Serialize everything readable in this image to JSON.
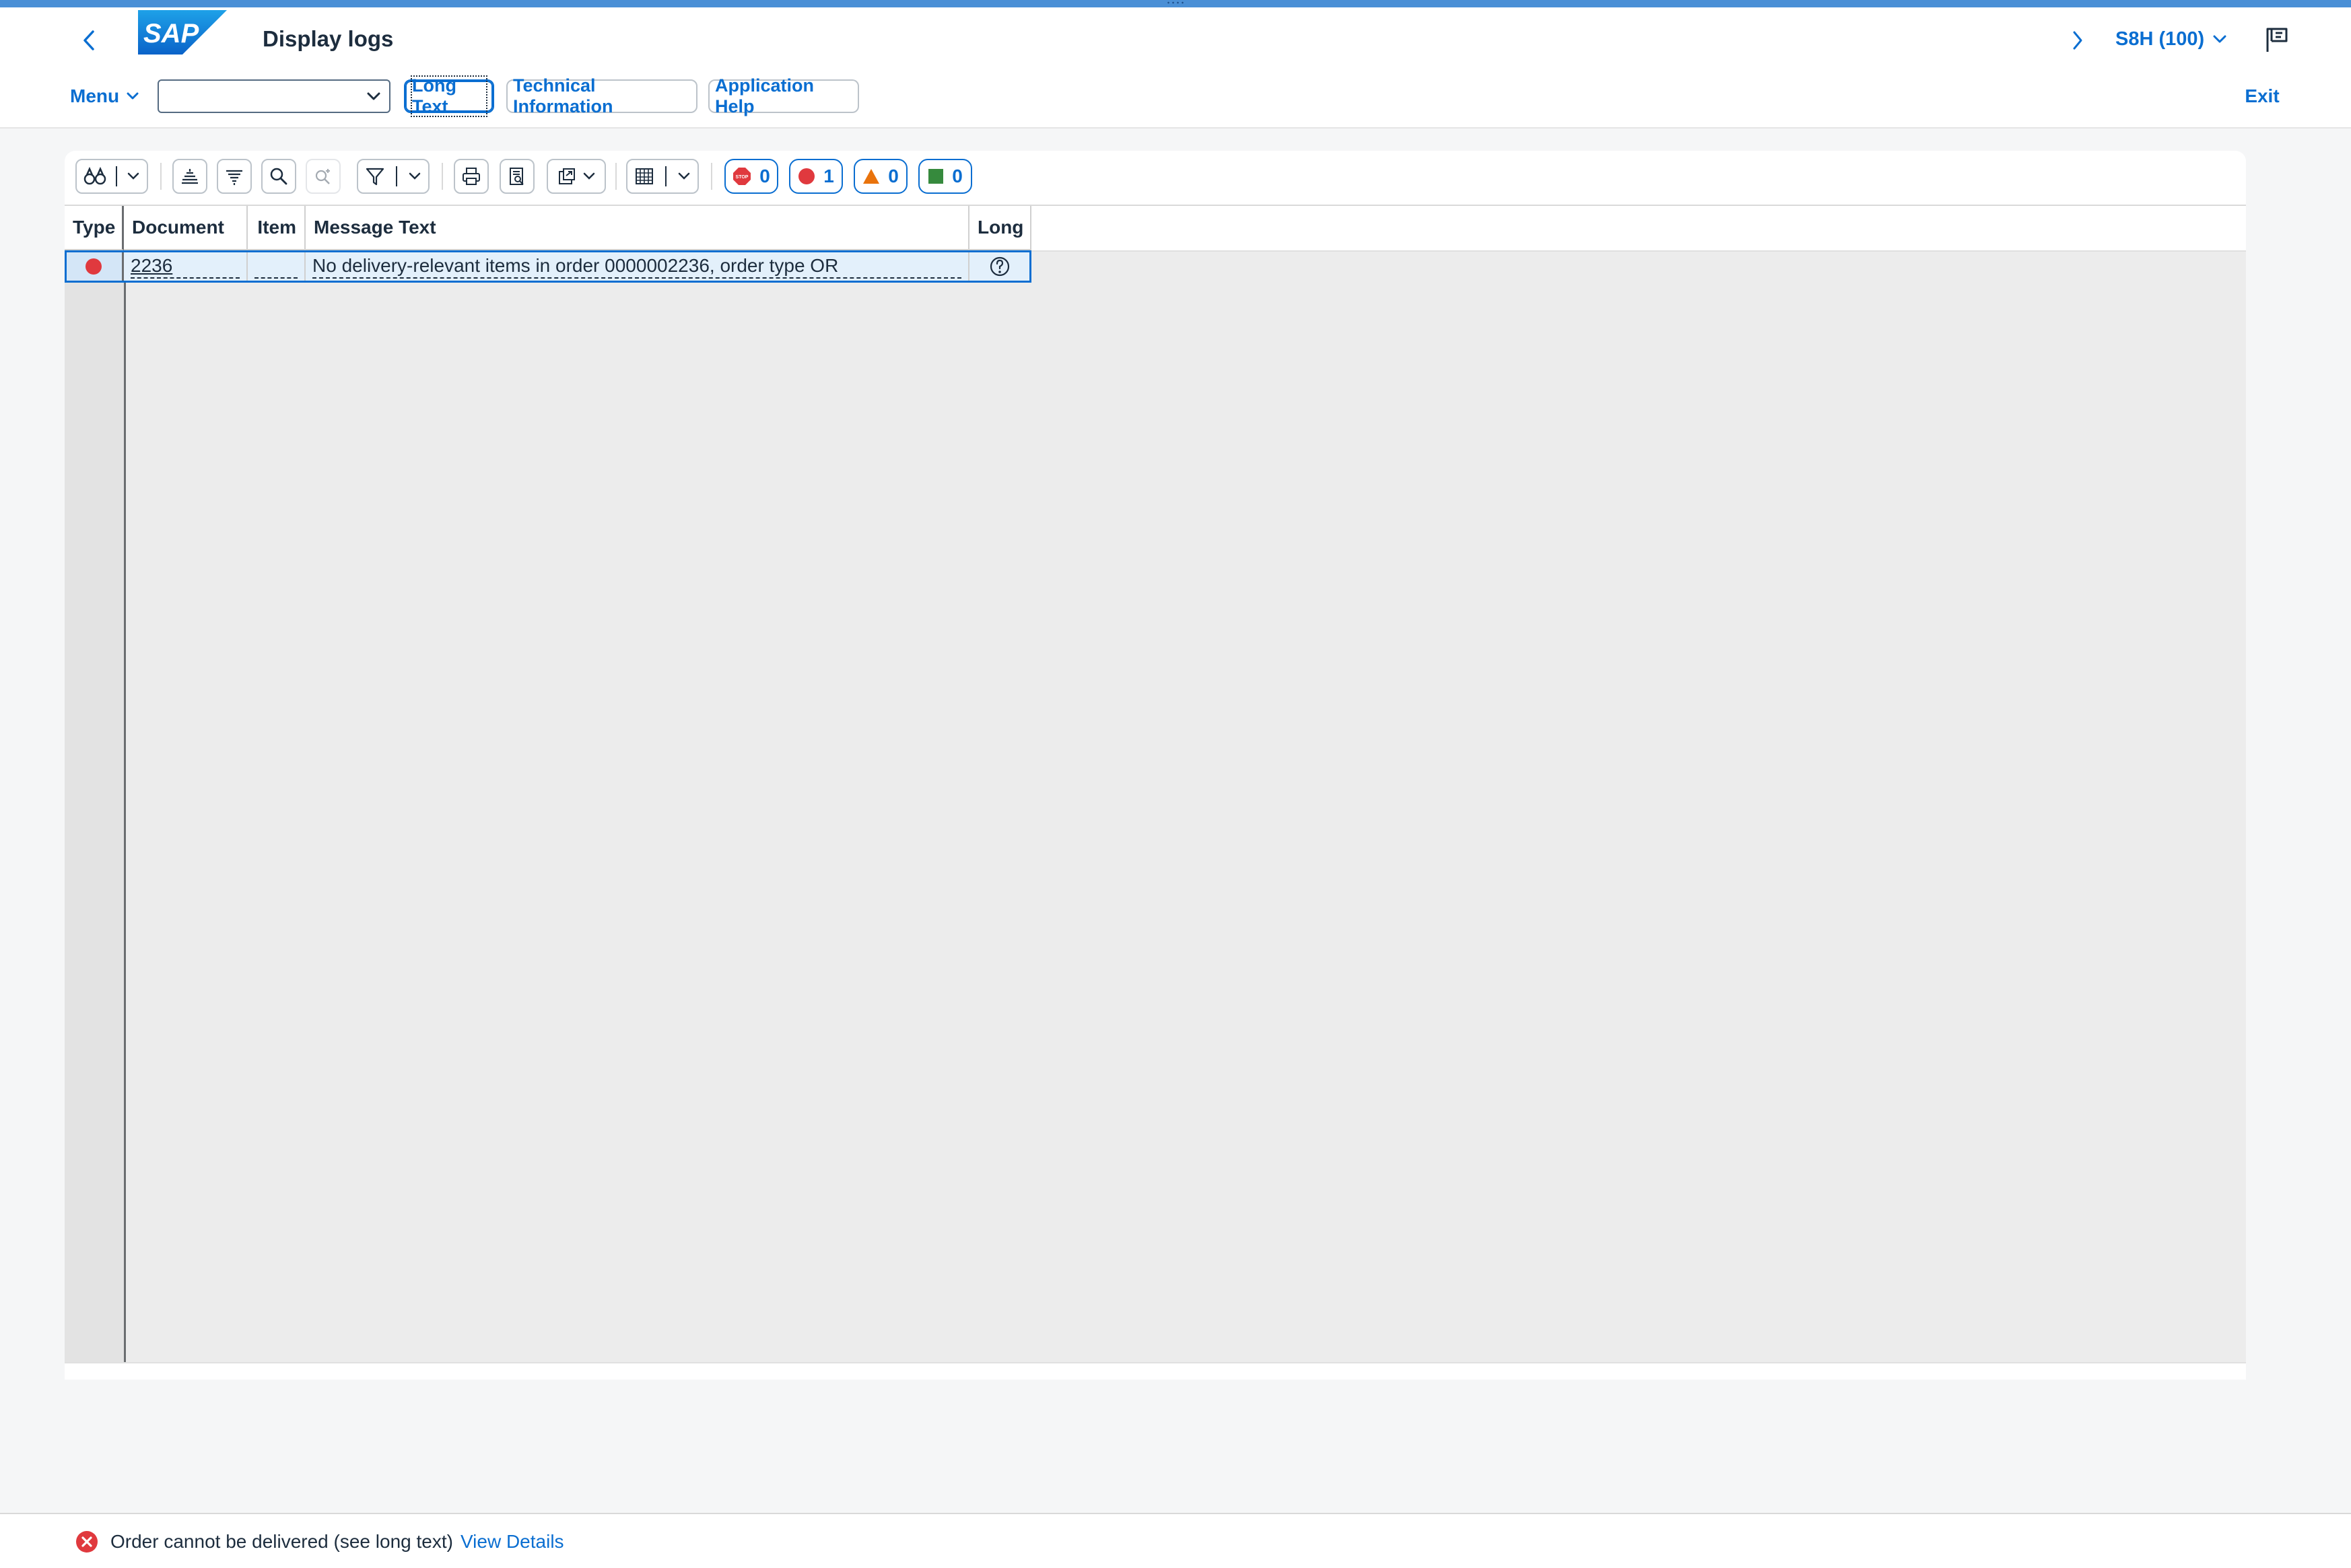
{
  "header": {
    "title": "Display logs",
    "logo_text": "SAP",
    "system": "S8H (100)"
  },
  "toolbar": {
    "menu_label": "Menu",
    "select_value": "",
    "long_text_label": "Long Text",
    "technical_info_label": "Technical Information",
    "application_help_label": "Application Help",
    "exit_label": "Exit"
  },
  "counters": {
    "stop": "0",
    "error": "1",
    "warning": "0",
    "success": "0"
  },
  "table": {
    "columns": [
      "Type",
      "Document",
      "Item",
      "Message Text",
      "Long"
    ],
    "rows": [
      {
        "type": "error",
        "document": "2236",
        "item": "",
        "message_text": "No delivery-relevant items in order 0000002236, order type OR",
        "long": "help"
      }
    ]
  },
  "status_bar": {
    "message": "Order cannot be delivered (see long text)",
    "details_link": "View Details"
  },
  "colors": {
    "accent": "#0a6ed1",
    "error": "#e0393e",
    "warning": "#e9730c",
    "success": "#368a3d",
    "top_line": "#4a8fd6"
  }
}
